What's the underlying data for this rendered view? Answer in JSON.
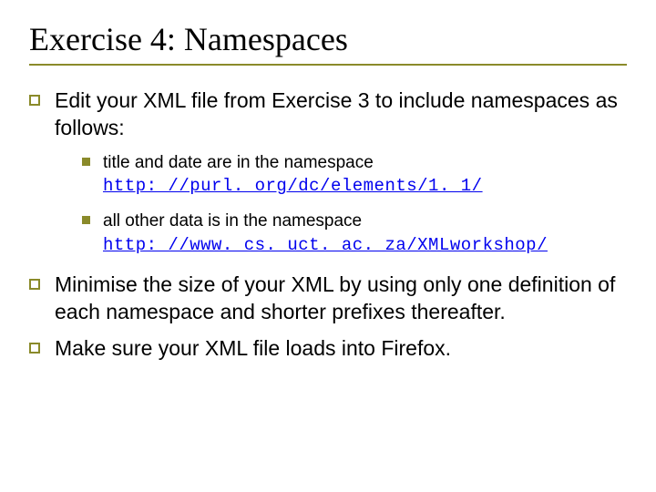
{
  "title": "Exercise 4: Namespaces",
  "bullets": {
    "b1": "Edit your XML file from Exercise 3 to include namespaces as follows:",
    "b2": "Minimise the size of your XML by using only one definition of each namespace and shorter prefixes thereafter.",
    "b3": "Make sure your XML file loads into Firefox."
  },
  "subs": {
    "s1_text": "title and date are in the namespace ",
    "s1_link": "http: //purl. org/dc/elements/1. 1/",
    "s2_text": "all other data is in the namespace ",
    "s2_link": "http: //www. cs. uct. ac. za/XMLworkshop/"
  }
}
